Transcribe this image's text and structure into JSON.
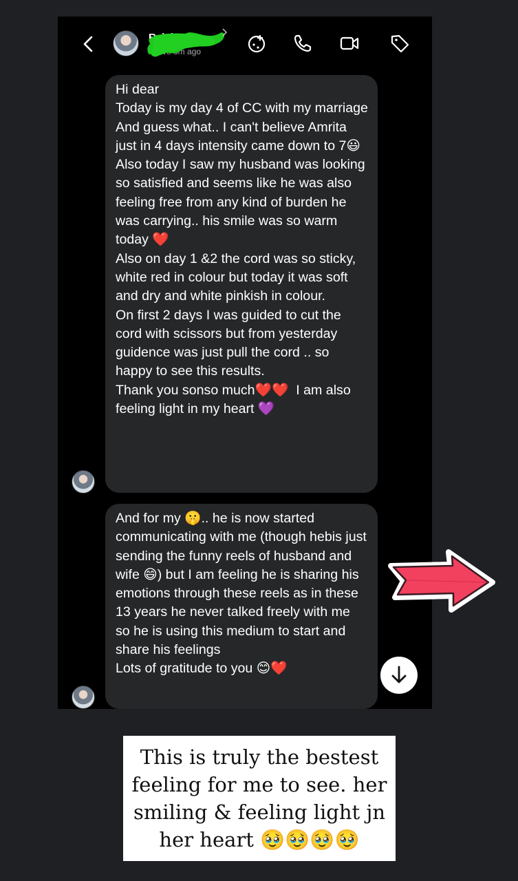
{
  "header": {
    "contact_name": "Rajshree",
    "status": "Active 6m ago",
    "icons": [
      "back-icon",
      "effects-icon",
      "phone-icon",
      "video-icon",
      "tag-icon"
    ]
  },
  "messages": [
    {
      "text": "Hi dear\nToday is my day 4 of CC with my marriage\nAnd guess what.. I can't believe Amrita just in 4 days intensity came down to 7😃\nAlso today I saw my husband was looking so satisfied and seems like he was also feeling free from any kind of burden he was carrying.. his smile was so warm today ❤️\nAlso on day 1 &2 the cord was so sticky, white red in colour but today it was soft and dry and white pinkish in colour.\nOn first 2 days I was guided to cut the cord with scissors but from yesterday guidence was just pull the cord .. so happy to see this results.\nThank you sonso much❤️❤️  I am also feeling light in my heart 💜"
    },
    {
      "text": "And for my 🤫.. he is now started communicating with me (though hebis just sending the funny reels of husband and wife 😄) but I am feeling he is sharing his emotions through these reels as in these 13 years he never talked freely with me so he is using this medium to start and share his feelings\nLots of gratitude to you 😊❤️"
    }
  ],
  "caption": "This is truly the bestest feeling for me to see. her smiling & feeling light jn her heart 🥹🥹🥹🥹",
  "colors": {
    "bubble": "#262729",
    "background": "#000000",
    "sticker_arrow": "#f2405f"
  }
}
